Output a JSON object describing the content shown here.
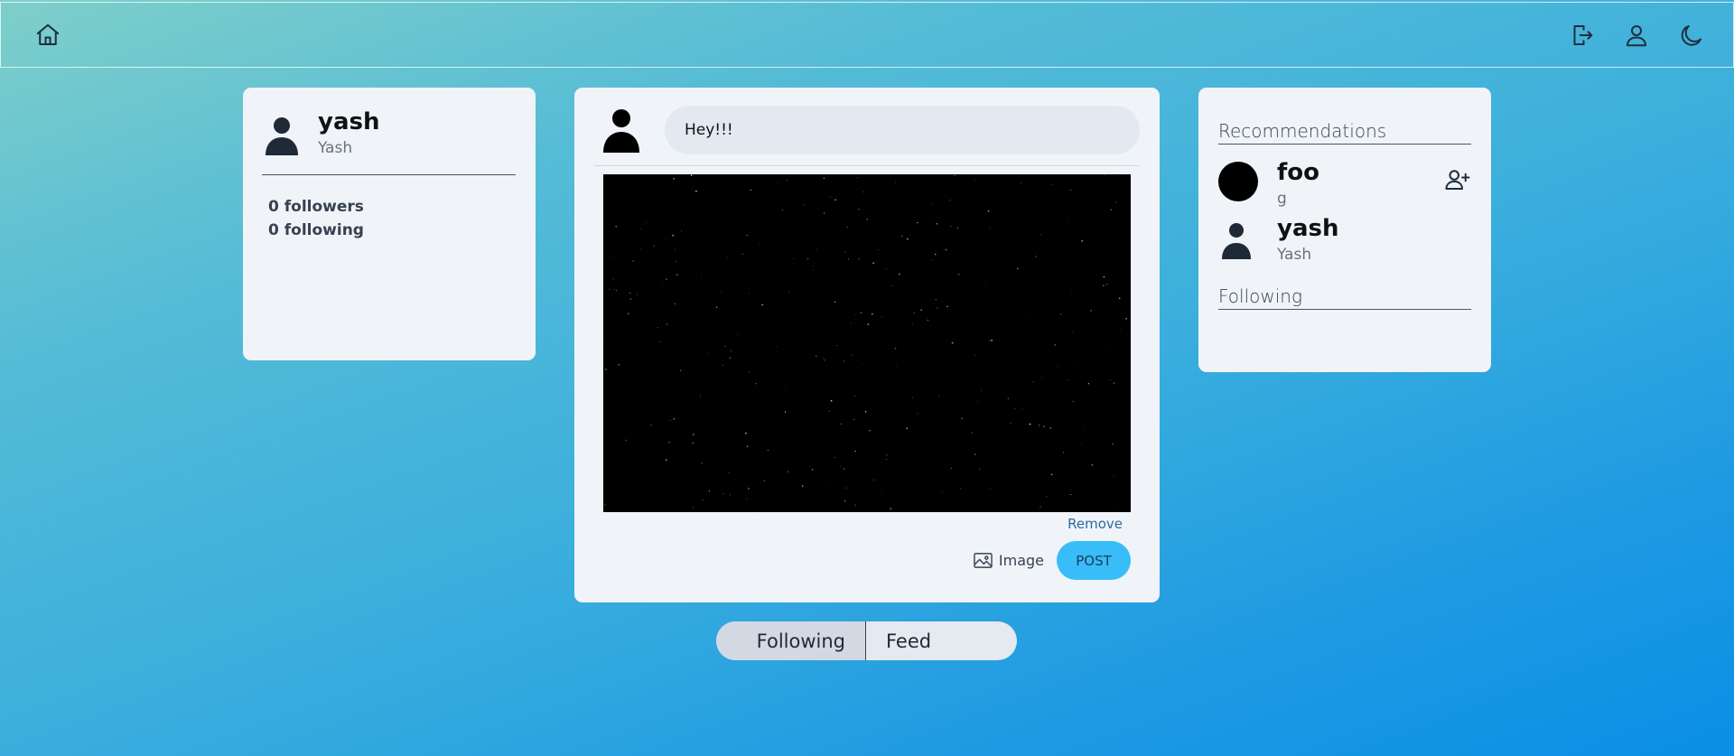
{
  "profile": {
    "username": "yash",
    "fullname": "Yash",
    "followers": "0 followers",
    "following": "0 following"
  },
  "composer": {
    "text": "Hey!!!",
    "remove_label": "Remove",
    "image_label": "Image",
    "post_label": "POST"
  },
  "recommendations": {
    "title": "Recommendations",
    "items": [
      {
        "name": "foo",
        "sub": "g"
      },
      {
        "name": "yash",
        "sub": "Yash"
      }
    ],
    "following_title": "Following"
  },
  "tabs": [
    {
      "label": "Following"
    },
    {
      "label": "Feed"
    }
  ],
  "colors": {
    "accent": "#38bdf8",
    "card": "#f0f4f8"
  },
  "icons": [
    "home-icon",
    "logout-icon",
    "user-icon",
    "moon-icon",
    "user-plus-icon",
    "image-icon"
  ]
}
